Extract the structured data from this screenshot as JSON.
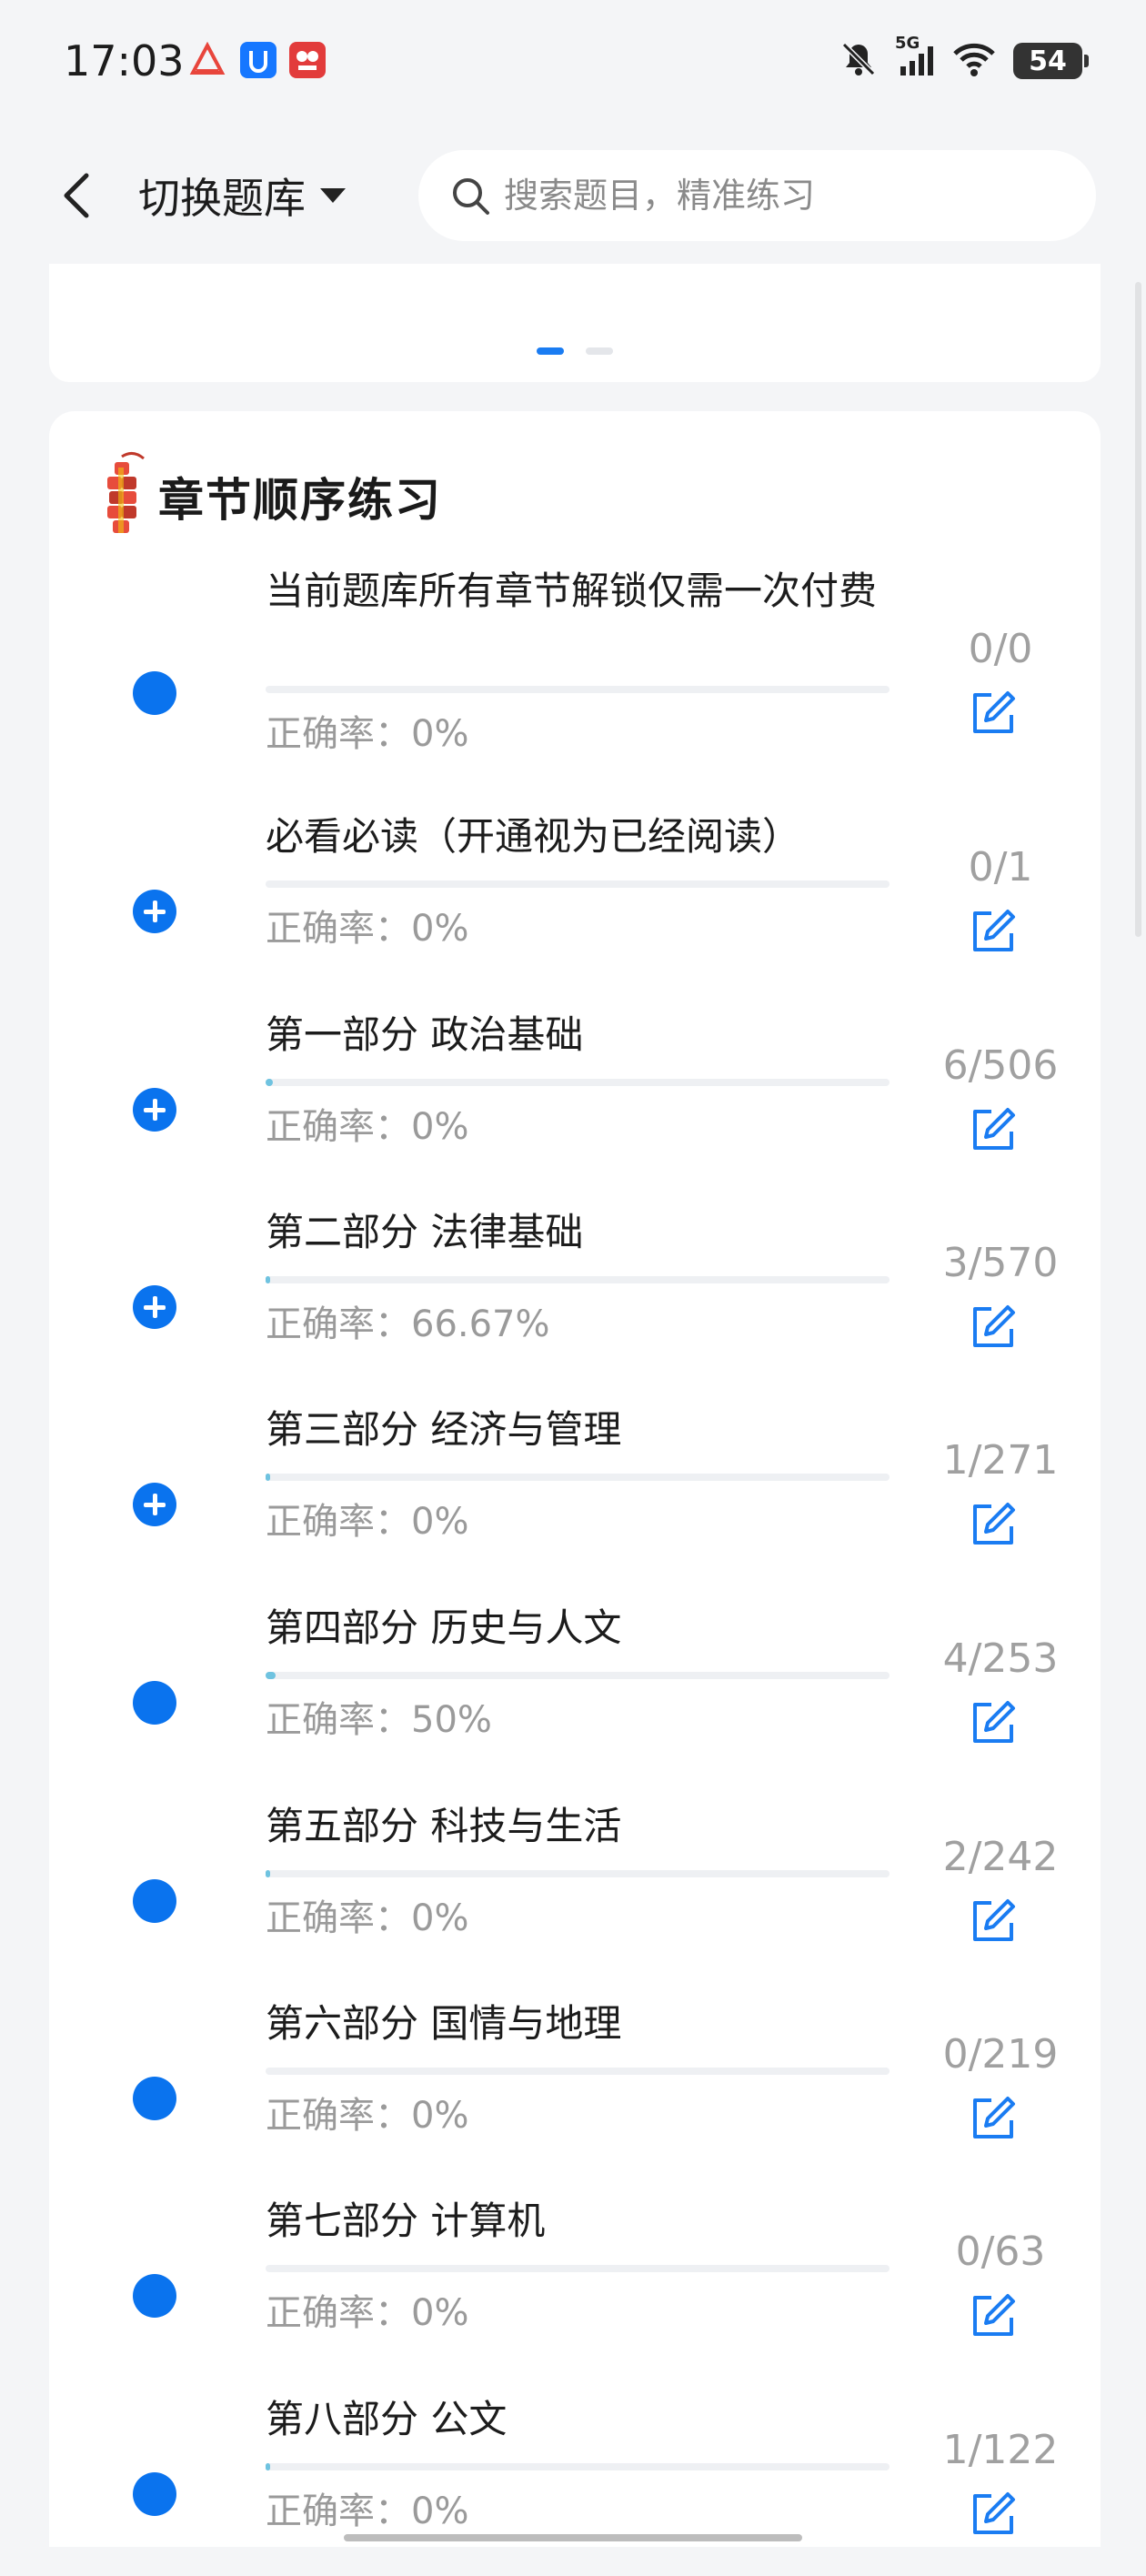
{
  "status_bar": {
    "time": "17:03",
    "battery": "54",
    "network": "5G",
    "icons": [
      "bell-off-icon",
      "signal-icon",
      "wifi-icon",
      "battery-icon"
    ]
  },
  "header": {
    "switch_label": "切换题库",
    "search_placeholder": "搜索题目，精准练习"
  },
  "section": {
    "title": "章节顺序练习"
  },
  "chapters": [
    {
      "title": "当前题库所有章节解锁仅需一次付费",
      "accuracy": "正确率：0%",
      "count": "0/0",
      "expandable": false,
      "progress": 0
    },
    {
      "title": "必看必读（开通视为已经阅读）",
      "accuracy": "正确率：0%",
      "count": "0/1",
      "expandable": true,
      "progress": 0
    },
    {
      "title": "第一部分 政治基础",
      "accuracy": "正确率：0%",
      "count": "6/506",
      "expandable": true,
      "progress": 0.012
    },
    {
      "title": "第二部分 法律基础",
      "accuracy": "正确率：66.67%",
      "count": "3/570",
      "expandable": true,
      "progress": 0.005
    },
    {
      "title": "第三部分 经济与管理",
      "accuracy": "正确率：0%",
      "count": "1/271",
      "expandable": true,
      "progress": 0.004
    },
    {
      "title": "第四部分 历史与人文",
      "accuracy": "正确率：50%",
      "count": "4/253",
      "expandable": false,
      "progress": 0.016
    },
    {
      "title": "第五部分 科技与生活",
      "accuracy": "正确率：0%",
      "count": "2/242",
      "expandable": false,
      "progress": 0.008
    },
    {
      "title": "第六部分 国情与地理",
      "accuracy": "正确率：0%",
      "count": "0/219",
      "expandable": false,
      "progress": 0
    },
    {
      "title": "第七部分 计算机",
      "accuracy": "正确率：0%",
      "count": "0/63",
      "expandable": false,
      "progress": 0
    },
    {
      "title": "第八部分 公文",
      "accuracy": "正确率：0%",
      "count": "1/122",
      "expandable": false,
      "progress": 0.008
    }
  ],
  "colors": {
    "accent": "#0a73ee",
    "progress": "#6fc3e0",
    "muted_text": "#9a9a9a"
  }
}
